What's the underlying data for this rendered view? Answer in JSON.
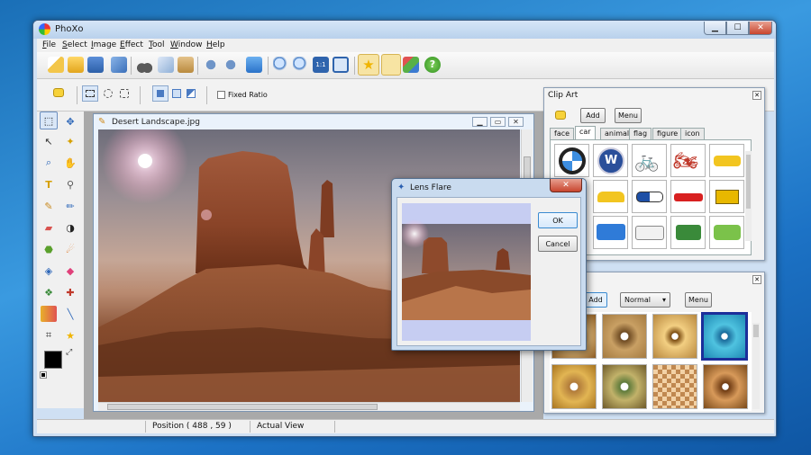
{
  "window": {
    "title": "PhoXo",
    "min_label": "▁",
    "max_label": "☐",
    "close_label": "✕"
  },
  "menu": [
    "File",
    "Select",
    "Image",
    "Effect",
    "Tool",
    "Window",
    "Help"
  ],
  "options": {
    "fixed_ratio_label": "Fixed Ratio"
  },
  "document": {
    "title": "Desert Landscape.jpg"
  },
  "status": {
    "position": "Position ( 488 , 59 )",
    "view": "Actual View"
  },
  "clip_art": {
    "title": "Clip Art",
    "add_label": "Add",
    "menu_label": "Menu",
    "tabs": [
      "face",
      "car",
      "animal",
      "flag",
      "figure",
      "icon"
    ],
    "active_tab": "car"
  },
  "effects_panel": {
    "add_label": "Add",
    "mode_value": "Normal",
    "menu_label": "Menu"
  },
  "dialog": {
    "title": "Lens Flare",
    "ok_label": "OK",
    "cancel_label": "Cancel"
  },
  "colors": {
    "foreground": "#000000",
    "background": "#ffffff",
    "accent": "#1f6fc4"
  }
}
